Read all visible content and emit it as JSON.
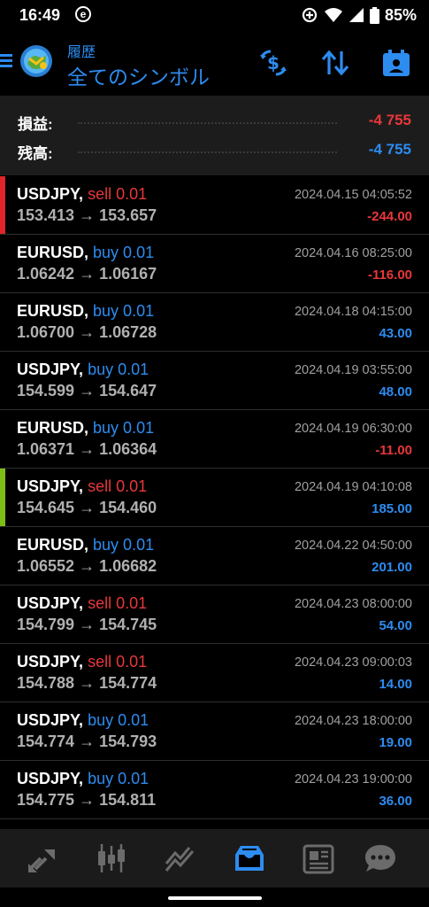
{
  "status_bar": {
    "time": "16:49",
    "app_badge": "e",
    "battery": "85%"
  },
  "header": {
    "subtitle": "履歴",
    "title": "全てのシンボル",
    "icons": [
      "menu-icon",
      "app-logo",
      "dollar-exchange-icon",
      "sort-icon",
      "calendar-icon"
    ]
  },
  "summary": {
    "profit_label": "損益:",
    "profit_value": "-4 755",
    "balance_label": "残高:",
    "balance_value": "-4 755"
  },
  "colors": {
    "red": "#e8373b",
    "blue": "#2d8cf0",
    "accent": "#2d8cf0",
    "marker_red": "#e0242a",
    "marker_green": "#7cbd16"
  },
  "trades": [
    {
      "symbol": "USDJPY,",
      "side": "sell 0.01",
      "side_type": "sell",
      "prices": "153.413 → 153.657",
      "time": "2024.04.15 04:05:52",
      "pl": "-244.00",
      "pl_type": "neg",
      "marker": "red"
    },
    {
      "symbol": "EURUSD,",
      "side": "buy 0.01",
      "side_type": "buy",
      "prices": "1.06242 → 1.06167",
      "time": "2024.04.16 08:25:00",
      "pl": "-116.00",
      "pl_type": "neg",
      "marker": ""
    },
    {
      "symbol": "EURUSD,",
      "side": "buy 0.01",
      "side_type": "buy",
      "prices": "1.06700 → 1.06728",
      "time": "2024.04.18 04:15:00",
      "pl": "43.00",
      "pl_type": "pos",
      "marker": ""
    },
    {
      "symbol": "USDJPY,",
      "side": "buy 0.01",
      "side_type": "buy",
      "prices": "154.599 → 154.647",
      "time": "2024.04.19 03:55:00",
      "pl": "48.00",
      "pl_type": "pos",
      "marker": ""
    },
    {
      "symbol": "EURUSD,",
      "side": "buy 0.01",
      "side_type": "buy",
      "prices": "1.06371 → 1.06364",
      "time": "2024.04.19 06:30:00",
      "pl": "-11.00",
      "pl_type": "neg",
      "marker": ""
    },
    {
      "symbol": "USDJPY,",
      "side": "sell 0.01",
      "side_type": "sell",
      "prices": "154.645 → 154.460",
      "time": "2024.04.19 04:10:08",
      "pl": "185.00",
      "pl_type": "pos",
      "marker": "green"
    },
    {
      "symbol": "EURUSD,",
      "side": "buy 0.01",
      "side_type": "buy",
      "prices": "1.06552 → 1.06682",
      "time": "2024.04.22 04:50:00",
      "pl": "201.00",
      "pl_type": "pos",
      "marker": ""
    },
    {
      "symbol": "USDJPY,",
      "side": "sell 0.01",
      "side_type": "sell",
      "prices": "154.799 → 154.745",
      "time": "2024.04.23 08:00:00",
      "pl": "54.00",
      "pl_type": "pos",
      "marker": ""
    },
    {
      "symbol": "USDJPY,",
      "side": "sell 0.01",
      "side_type": "sell",
      "prices": "154.788 → 154.774",
      "time": "2024.04.23 09:00:03",
      "pl": "14.00",
      "pl_type": "pos",
      "marker": ""
    },
    {
      "symbol": "USDJPY,",
      "side": "buy 0.01",
      "side_type": "buy",
      "prices": "154.774 → 154.793",
      "time": "2024.04.23 18:00:00",
      "pl": "19.00",
      "pl_type": "pos",
      "marker": ""
    },
    {
      "symbol": "USDJPY,",
      "side": "buy 0.01",
      "side_type": "buy",
      "prices": "154.775 → 154.811",
      "time": "2024.04.23 19:00:00",
      "pl": "36.00",
      "pl_type": "pos",
      "marker": ""
    }
  ],
  "bottom_nav": {
    "items": [
      "quotes-icon",
      "chart-icon",
      "trade-icon",
      "history-icon",
      "news-icon",
      "chat-icon"
    ],
    "active_index": 3
  }
}
